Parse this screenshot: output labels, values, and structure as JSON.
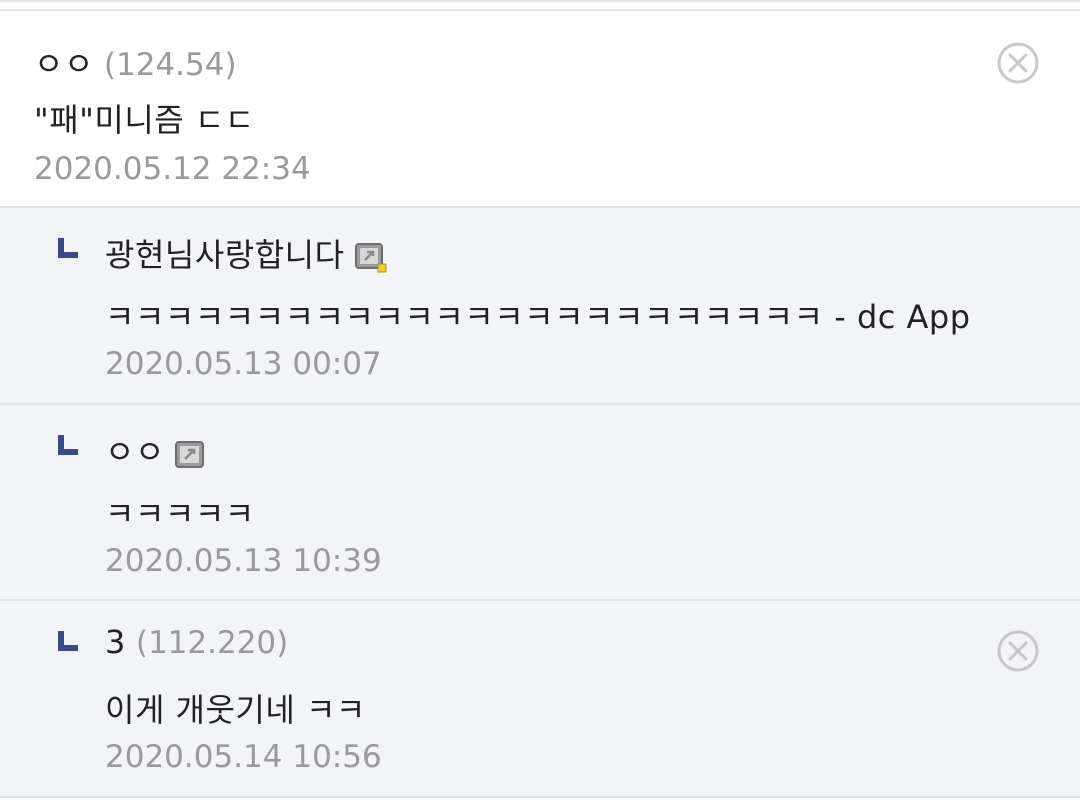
{
  "comments": [
    {
      "author": "ㅇㅇ",
      "ip": "(124.54)",
      "text": "\"패\"미니즘 ㄷㄷ",
      "date": "2020.05.12 22:34",
      "delete_icon": "close-circle-icon"
    },
    {
      "author": "광현님사랑합니다",
      "text": "ㅋㅋㅋㅋㅋㅋㅋㅋㅋㅋㅋㅋㅋㅋㅋㅋㅋㅋㅋㅋㅋㅋㅋㅋ - dc App",
      "date": "2020.05.13 00:07",
      "badge_icon": "fixed-nick-badge-icon"
    },
    {
      "author": "ㅇㅇ",
      "text": "ㅋㅋㅋㅋㅋ",
      "date": "2020.05.13 10:39",
      "badge_icon": "nick-badge-icon"
    },
    {
      "author": "3",
      "ip": "(112.220)",
      "text": "이게 개웃기네 ㅋㅋ",
      "date": "2020.05.14 10:56",
      "delete_icon": "close-circle-icon"
    }
  ],
  "colors": {
    "reply_bg": "#f3f4f8",
    "reply_mark": "#3b4a8c",
    "muted_text": "#9a9a9a",
    "text": "#222222"
  }
}
